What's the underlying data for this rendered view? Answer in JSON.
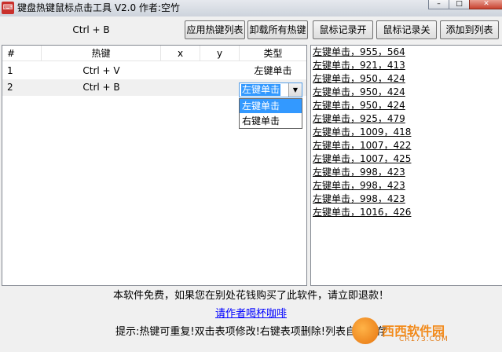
{
  "window": {
    "title": "键盘热键鼠标点击工具 V2.0 作者:空竹",
    "app_icon": "key-mouse-icon"
  },
  "toolbar": {
    "current_hotkey": "Ctrl + B",
    "apply_hotkeys": "应用热键列表",
    "unload_hotkeys": "卸载所有热键",
    "record_start": "鼠标记录开",
    "record_stop": "鼠标记录关",
    "add_to_list": "添加到列表"
  },
  "table": {
    "columns": [
      "#",
      "热键",
      "x",
      "y",
      "类型"
    ],
    "rows": [
      {
        "num": "1",
        "hotkey": "Ctrl + V",
        "x": "",
        "y": "",
        "type": "左键单击"
      },
      {
        "num": "2",
        "hotkey": "Ctrl + B",
        "x": "",
        "y": "",
        "type": "左键单击"
      }
    ],
    "dropdown_options": [
      "左键单击",
      "右键单击"
    ]
  },
  "log": [
    "左键单击，955，564",
    "左键单击，921，413",
    "左键单击，950，424",
    "左键单击，950，424",
    "左键单击，950，424",
    "左键单击，925，479",
    "左键单击，1009，418",
    "左键单击，1007，422",
    "左键单击，1007，425",
    "左键单击，998，423",
    "左键单击，998，423",
    "左键单击，998，423",
    "左键单击，1016，426"
  ],
  "footer": {
    "notice": "本软件免费，如果您在别处花钱购买了此软件，请立即退款！",
    "coffee_link": "请作者喝杯咖啡",
    "tip": "提示:热键可重复!双击表项修改!右键表项删除!列表自动保存"
  },
  "watermark": {
    "name": "西西软件园",
    "url": "CR173.COM"
  }
}
